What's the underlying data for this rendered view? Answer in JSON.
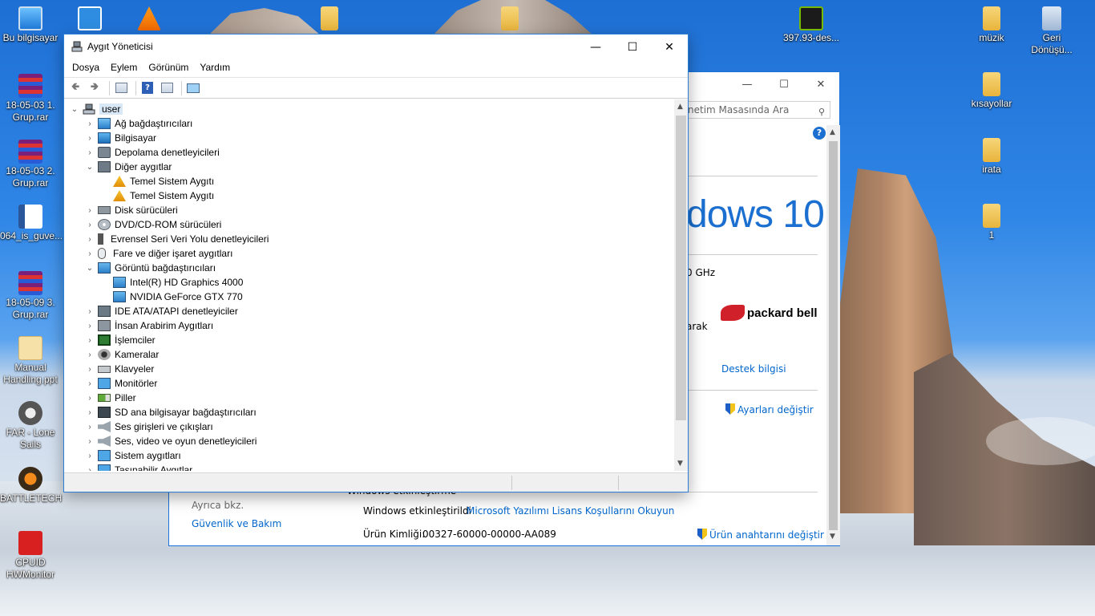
{
  "desktop": {
    "icons_left": [
      {
        "label": "Bu bilgisayar",
        "icon": "computer-icon"
      },
      {
        "label": "18-05-03 1. Grup.rar",
        "icon": "rar-archive-icon"
      },
      {
        "label": "18-05-03 2. Grup.rar",
        "icon": "rar-archive-icon"
      },
      {
        "label": "064_is_guve...",
        "icon": "word-document-icon"
      },
      {
        "label": "18-05-09 3. Grup.rar",
        "icon": "rar-archive-icon"
      },
      {
        "label": "Manual Handling.ppt",
        "icon": "powerpoint-icon"
      },
      {
        "label": "FAR - Lone Sails",
        "icon": "game-icon"
      },
      {
        "label": "BATTLETECH",
        "icon": "battletech-icon"
      },
      {
        "label": "CPUID HWMonitor",
        "icon": "hwmonitor-icon"
      }
    ],
    "icons_right": [
      {
        "label": "397.93-des...",
        "icon": "nvidia-icon"
      },
      {
        "label": "müzik",
        "icon": "folder-icon"
      },
      {
        "label": "Geri Dönüşü...",
        "icon": "recycle-bin-icon"
      },
      {
        "label": "kısayollar",
        "icon": "folder-icon"
      },
      {
        "label": "irata",
        "icon": "folder-icon"
      },
      {
        "label": "1",
        "icon": "folder-icon"
      }
    ]
  },
  "system_window": {
    "search_placeholder": "netim Masasında Ara",
    "windows_logo_text": "dows 10",
    "cpu_fragment": "0 GHz",
    "fragment_arak": "arak",
    "brand": "packard bell",
    "support_link": "Destek bilgisi",
    "change_settings": "Ayarları değiştir",
    "see_also": "Ayrıca bkz.",
    "security_link": "Güvenlik ve Bakım",
    "activation_heading": "Windows etkinleştirme",
    "activated_text": "Windows etkinleştirildi",
    "license_link": "Microsoft Yazılımı Lisans Koşullarını Okuyun",
    "product_id_label": "Ürün Kimliği:",
    "product_id_value": "00327-60000-00000-AA089",
    "change_key": "Ürün anahtarını değiştir"
  },
  "device_manager": {
    "title": "Aygıt Yöneticisi",
    "menu": [
      "Dosya",
      "Eylem",
      "Görünüm",
      "Yardım"
    ],
    "root": "user",
    "tree": [
      {
        "label": "Ağ bağdaştırıcıları",
        "icon": "network-adapter-icon",
        "expanded": false
      },
      {
        "label": "Bilgisayar",
        "icon": "computer-icon",
        "expanded": false
      },
      {
        "label": "Depolama denetleyicileri",
        "icon": "storage-controller-icon",
        "expanded": false
      },
      {
        "label": "Diğer aygıtlar",
        "icon": "other-devices-icon",
        "expanded": true,
        "children": [
          "Temel Sistem Aygıtı",
          "Temel Sistem Aygıtı"
        ]
      },
      {
        "label": "Disk sürücüleri",
        "icon": "disk-drive-icon",
        "expanded": false
      },
      {
        "label": "DVD/CD-ROM sürücüleri",
        "icon": "dvd-drive-icon",
        "expanded": false
      },
      {
        "label": "Evrensel Seri Veri Yolu denetleyicileri",
        "icon": "usb-icon",
        "expanded": false
      },
      {
        "label": "Fare ve diğer işaret aygıtları",
        "icon": "mouse-icon",
        "expanded": false
      },
      {
        "label": "Görüntü bağdaştırıcıları",
        "icon": "display-adapter-icon",
        "expanded": true,
        "children": [
          "Intel(R) HD Graphics 4000",
          "NVIDIA GeForce GTX 770"
        ]
      },
      {
        "label": "IDE ATA/ATAPI denetleyiciler",
        "icon": "ide-controller-icon",
        "expanded": false
      },
      {
        "label": "İnsan Arabirim Aygıtları",
        "icon": "hid-icon",
        "expanded": false
      },
      {
        "label": "İşlemciler",
        "icon": "processor-icon",
        "expanded": false
      },
      {
        "label": "Kameralar",
        "icon": "camera-icon",
        "expanded": false
      },
      {
        "label": "Klavyeler",
        "icon": "keyboard-icon",
        "expanded": false
      },
      {
        "label": "Monitörler",
        "icon": "monitor-icon",
        "expanded": false
      },
      {
        "label": "Piller",
        "icon": "battery-icon",
        "expanded": false
      },
      {
        "label": "SD ana bilgisayar bağdaştırıcıları",
        "icon": "sd-host-icon",
        "expanded": false
      },
      {
        "label": "Ses girişleri ve çıkışları",
        "icon": "audio-io-icon",
        "expanded": false
      },
      {
        "label": "Ses, video ve oyun denetleyicileri",
        "icon": "sound-controller-icon",
        "expanded": false
      },
      {
        "label": "Sistem aygıtları",
        "icon": "system-devices-icon",
        "expanded": false
      },
      {
        "label": "Taşınabilir Aygıtlar",
        "icon": "portable-devices-icon",
        "expanded": false
      }
    ]
  },
  "colors": {
    "accent": "#1a73d8",
    "link": "#0066cc",
    "selection": "#d9e8f7"
  }
}
